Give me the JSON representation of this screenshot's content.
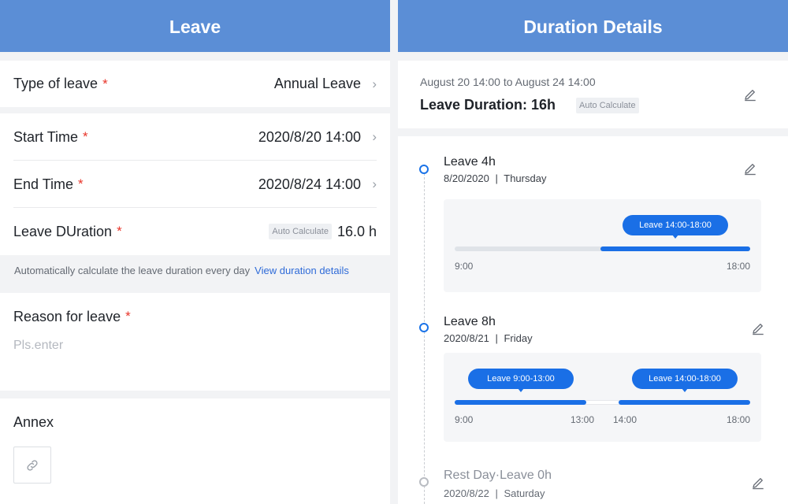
{
  "left": {
    "title": "Leave",
    "type_label": "Type of leave",
    "type_value": "Annual Leave",
    "required_mark": "*",
    "start_label": "Start Time",
    "start_value": "2020/8/20 14:00",
    "end_label": "End Time",
    "end_value": "2020/8/24 14:00",
    "duration_label": "Leave DUration",
    "auto_badge": "Auto Calculate",
    "duration_value": "16.0 h",
    "hint_text": "Automatically calculate the leave duration every day",
    "hint_link": "View duration details",
    "reason_label": "Reason for leave",
    "reason_placeholder": "Pls.enter",
    "annex_label": "Annex",
    "chevron": "›"
  },
  "right": {
    "title": "Duration Details",
    "range": "August 20 14:00 to August 24 14:00",
    "total": "Leave Duration: 16h",
    "auto_badge": "Auto Calculate",
    "days": [
      {
        "title": "Leave 4h",
        "date": "8/20/2020",
        "weekday": "Thursday",
        "status_color": "#1a73e8",
        "segments": [
          {
            "label": "Leave 14:00-18:00",
            "start": "14:00",
            "end": "18:00",
            "fraction_start": 0.5,
            "fraction_end": 1.0
          }
        ],
        "ticks": [
          "9:00",
          "18:00"
        ]
      },
      {
        "title": "Leave 8h",
        "date": "2020/8/21",
        "weekday": "Friday",
        "status_color": "#1a73e8",
        "segments": [
          {
            "label": "Leave 9:00-13:00",
            "start": "9:00",
            "end": "13:00",
            "fraction_start": 0.0,
            "fraction_end": 0.444
          },
          {
            "label": "Leave 14:00-18:00",
            "start": "14:00",
            "end": "18:00",
            "fraction_start": 0.556,
            "fraction_end": 1.0
          }
        ],
        "ticks": [
          "9:00",
          "13:00",
          "14:00",
          "18:00"
        ]
      },
      {
        "title": "Rest Day·Leave 0h",
        "date": "2020/8/22",
        "weekday": "Saturday",
        "status_color": "#b9bcc2"
      }
    ],
    "separator": "|"
  },
  "icons": {
    "edit": "pencil-icon",
    "attach": "link-icon",
    "chevron": "chevron-right-icon"
  },
  "colors": {
    "header": "#5b8ed6",
    "accent": "#1a6fe6",
    "required": "#e8352a"
  }
}
